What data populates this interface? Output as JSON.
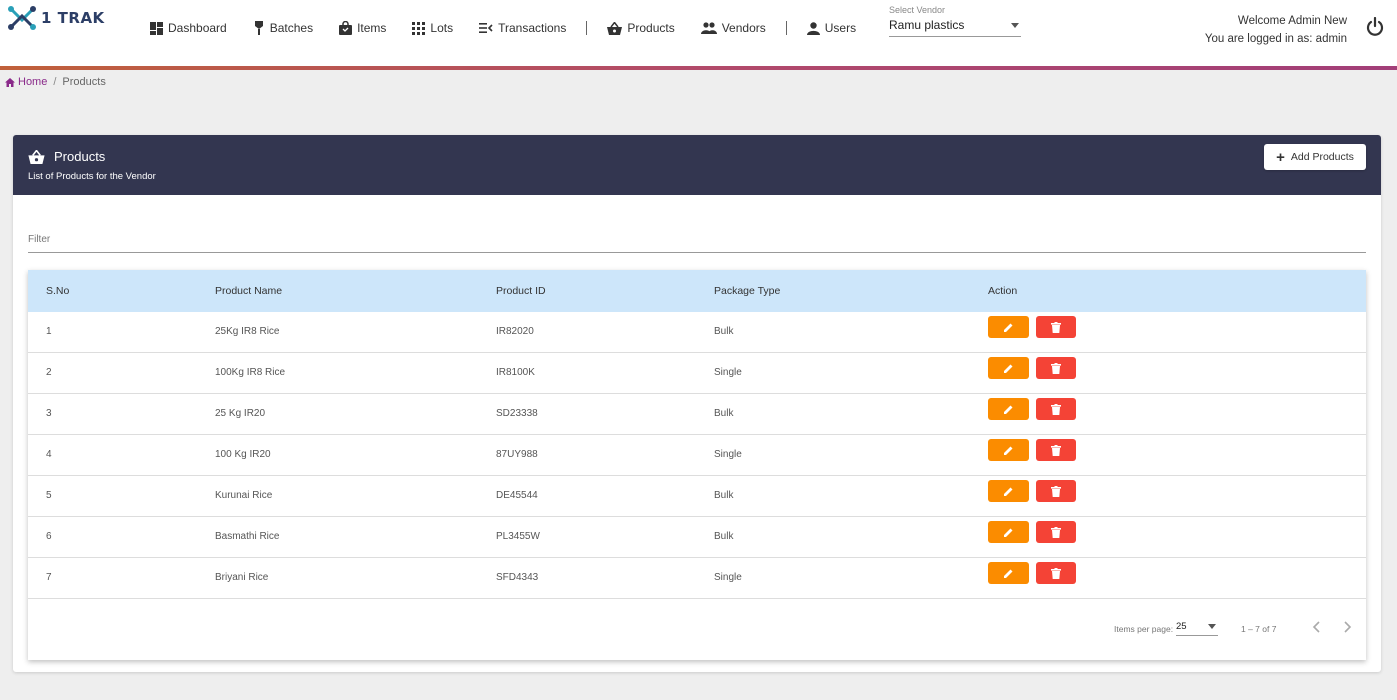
{
  "app": {
    "logo_text": "1 TRAK"
  },
  "nav": [
    {
      "label": "Dashboard",
      "icon": "dashboard-icon"
    },
    {
      "label": "Batches",
      "icon": "batch-icon"
    },
    {
      "label": "Items",
      "icon": "shopping-bag-icon"
    },
    {
      "label": "Lots",
      "icon": "grid-icon"
    },
    {
      "label": "Transactions",
      "icon": "transactions-icon"
    },
    {
      "label": "Products",
      "icon": "basket-icon"
    },
    {
      "label": "Vendors",
      "icon": "people-icon"
    },
    {
      "label": "Users",
      "icon": "user-icon"
    }
  ],
  "vendor": {
    "label": "Select Vendor",
    "value": "Ramu plastics"
  },
  "user": {
    "welcome": "Welcome Admin New",
    "logged_in": "You are logged in as: admin"
  },
  "breadcrumb": {
    "home": "Home",
    "separator": "/",
    "current": "Products"
  },
  "card": {
    "title": "Products",
    "subtitle": "List of Products for the Vendor",
    "add_button": "Add Products",
    "add_button_symbol": "+"
  },
  "filter": {
    "placeholder": "Filter"
  },
  "table": {
    "headers": [
      "S.No",
      "Product Name",
      "Product ID",
      "Package Type",
      "Action"
    ],
    "rows": [
      {
        "sno": "1",
        "name": "25Kg IR8 Rice",
        "id": "IR82020",
        "type": "Bulk"
      },
      {
        "sno": "2",
        "name": "100Kg IR8 Rice",
        "id": "IR8100K",
        "type": "Single"
      },
      {
        "sno": "3",
        "name": "25 Kg IR20",
        "id": "SD23338",
        "type": "Bulk"
      },
      {
        "sno": "4",
        "name": "100 Kg IR20",
        "id": "87UY988",
        "type": "Single"
      },
      {
        "sno": "5",
        "name": "Kurunai Rice",
        "id": "DE45544",
        "type": "Bulk"
      },
      {
        "sno": "6",
        "name": "Basmathi Rice",
        "id": "PL3455W",
        "type": "Bulk"
      },
      {
        "sno": "7",
        "name": "Briyani Rice",
        "id": "SFD4343",
        "type": "Single"
      }
    ]
  },
  "paginator": {
    "items_per_page_label": "Items per page:",
    "items_per_page": "25",
    "range": "1 – 7 of 7"
  },
  "colors": {
    "header_bar": "#333650",
    "table_header": "#cde6fa",
    "edit": "#fb8c00",
    "delete": "#f44336",
    "accent": "#8a2a8a"
  }
}
